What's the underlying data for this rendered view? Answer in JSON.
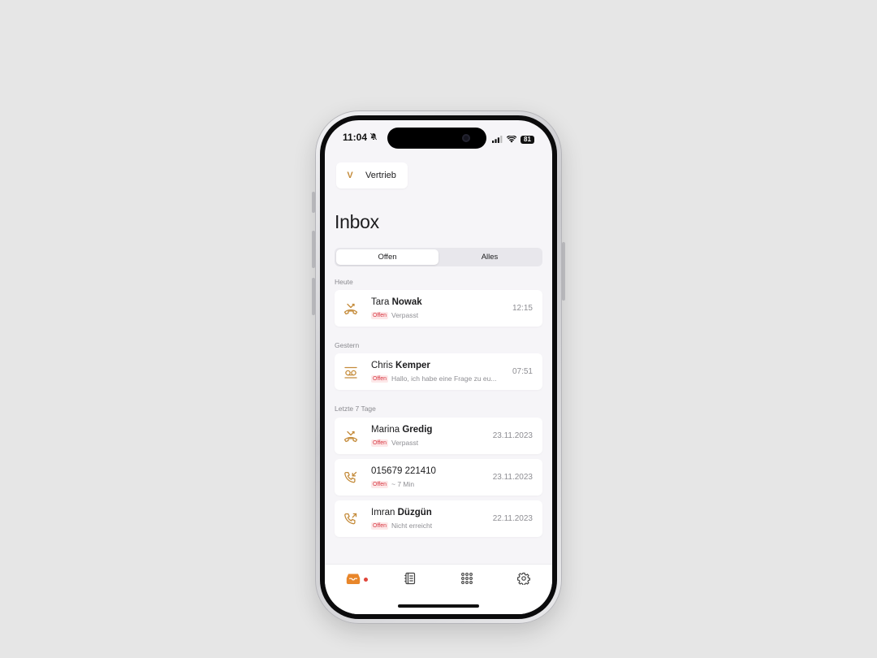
{
  "status_bar": {
    "time": "11:04",
    "battery": "81",
    "icons": [
      "bell-slash-icon",
      "signal-icon",
      "wifi-icon",
      "battery-icon"
    ]
  },
  "workspace": {
    "initial": "V",
    "name": "Vertrieb"
  },
  "page": {
    "title": "Inbox"
  },
  "filter_tabs": [
    {
      "label": "Offen",
      "active": true
    },
    {
      "label": "Alles",
      "active": false
    }
  ],
  "sections": [
    {
      "title": "Heute",
      "items": [
        {
          "icon": "missed-call-icon",
          "first": "Tara",
          "last": "Nowak",
          "badge": "Offen",
          "detail": "Verpasst",
          "time": "12:15"
        }
      ]
    },
    {
      "title": "Gestern",
      "items": [
        {
          "icon": "voicemail-icon",
          "first": "Chris",
          "last": "Kemper",
          "badge": "Offen",
          "detail": "Hallo, ich habe eine Frage zu eu...",
          "time": "07:51"
        }
      ]
    },
    {
      "title": "Letzte 7 Tage",
      "items": [
        {
          "icon": "missed-call-icon",
          "first": "Marina",
          "last": "Gredig",
          "badge": "Offen",
          "detail": "Verpasst",
          "time": "23.11.2023"
        },
        {
          "icon": "incoming-call-icon",
          "first": "015679 221410",
          "last": "",
          "badge": "Offen",
          "detail": "~ 7 Min",
          "time": "23.11.2023"
        },
        {
          "icon": "outgoing-call-icon",
          "first": "Imran",
          "last": "Düzgün",
          "badge": "Offen",
          "detail": "Nicht erreicht",
          "time": "22.11.2023"
        }
      ]
    }
  ],
  "tab_bar": [
    {
      "icon": "inbox-icon",
      "active": true,
      "has_notification": true
    },
    {
      "icon": "contacts-book-icon",
      "active": false,
      "has_notification": false
    },
    {
      "icon": "dialpad-icon",
      "active": false,
      "has_notification": false
    },
    {
      "icon": "gear-icon",
      "active": false,
      "has_notification": false
    }
  ],
  "colors": {
    "accent": "#e8862a",
    "icon_gold": "#c48b3a",
    "badge_text": "#d6343e",
    "badge_bg": "#fde8e9",
    "background": "#f6f5f8"
  }
}
